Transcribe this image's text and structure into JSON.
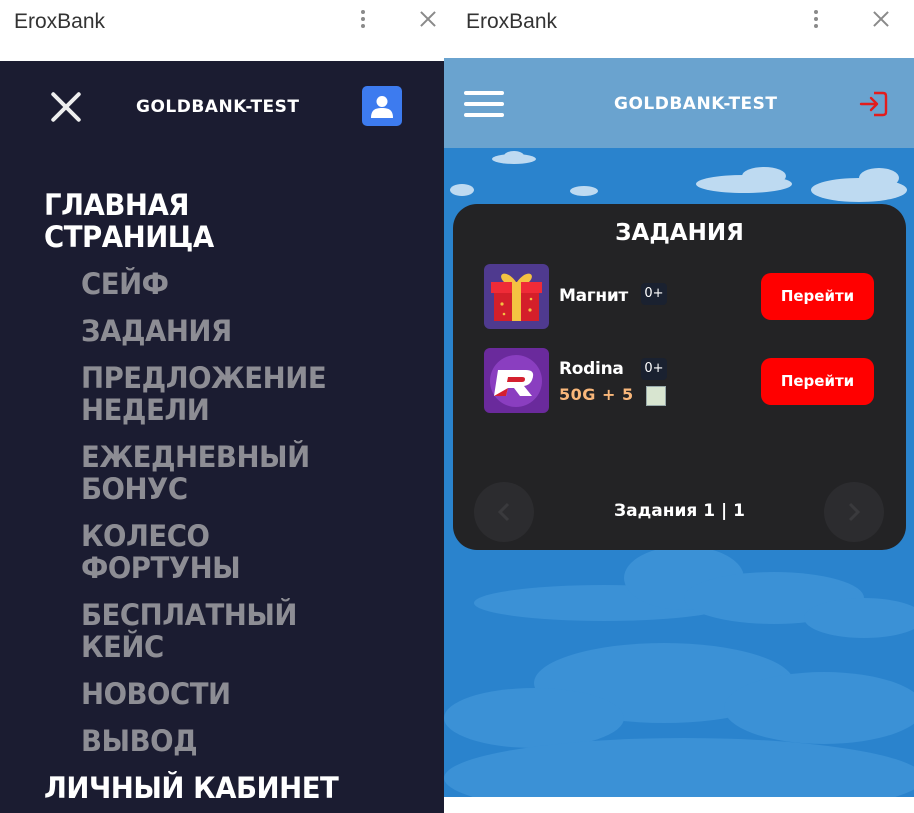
{
  "left_window": {
    "title": "EroxBank",
    "brand": "GOLDBANK-TEST",
    "menu": {
      "home": "ГЛАВНАЯ СТРАНИЦА",
      "items": [
        "СЕЙФ",
        "ЗАДАНИЯ",
        "ПРЕДЛОЖЕНИЕ НЕДЕЛИ",
        "ЕЖЕДНЕВНЫЙ БОНУС",
        "КОЛЕСО ФОРТУНЫ",
        "БЕСПЛАТНЫЙ КЕЙС",
        "НОВОСТИ",
        "ВЫВОД"
      ],
      "account": "ЛИЧНЫЙ КАБИНЕТ"
    }
  },
  "right_window": {
    "title": "EroxBank",
    "brand": "GOLDBANK-TEST",
    "tasks": {
      "heading": "ЗАДАНИЯ",
      "items": [
        {
          "name": "Магнит",
          "age": "0+",
          "button": "Перейти",
          "icon": "gift-icon"
        },
        {
          "name": "Rodina",
          "age": "0+",
          "reward": "50G + 5",
          "button": "Перейти",
          "icon": "rodina-logo-icon"
        }
      ],
      "pager": "Задания 1 | 1"
    }
  },
  "colors": {
    "menu_bg": "#1b1c31",
    "sky_blue": "#2a83cd",
    "topbar": "#6aa3cf",
    "card_bg": "#232325",
    "accent_red": "#ff0000",
    "profile_blue": "#3d7bef",
    "reward_orange": "#f9b77a"
  }
}
